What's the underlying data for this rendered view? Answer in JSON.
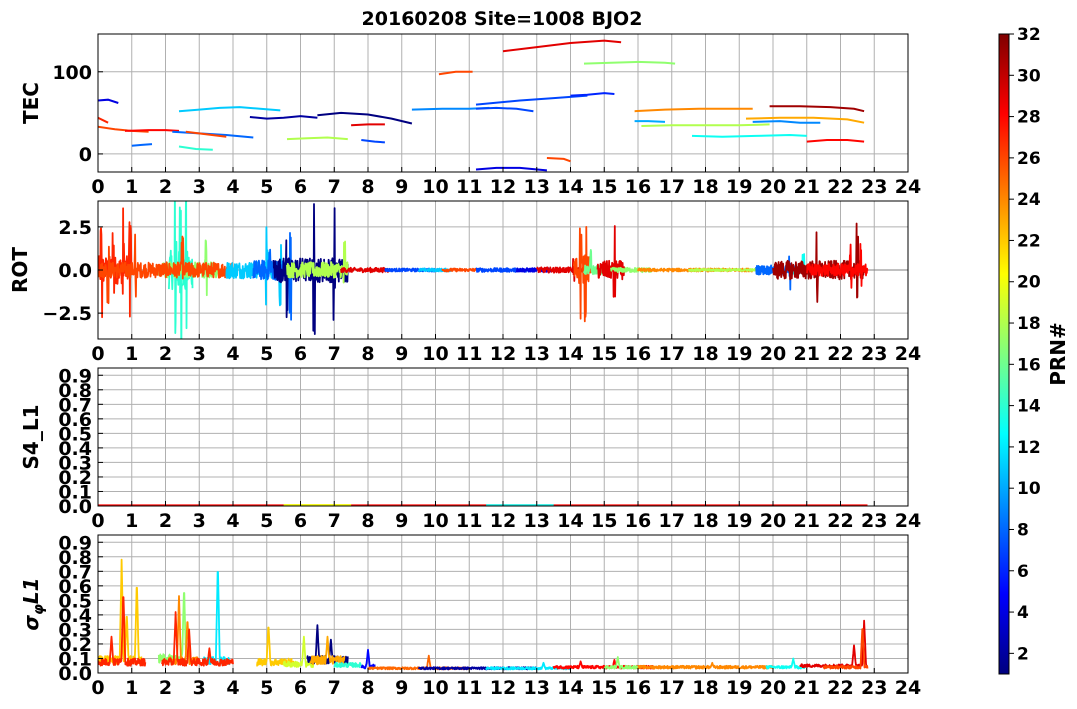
{
  "figure": {
    "title": "20160208 Site=1008 BJO2"
  },
  "chart_data": [
    {
      "type": "line",
      "panel": "tec",
      "ylabel": "TEC",
      "xlim": [
        0,
        24
      ],
      "ylim": [
        -22,
        146
      ],
      "xticks": [
        0,
        1,
        2,
        3,
        4,
        5,
        6,
        7,
        8,
        9,
        10,
        11,
        12,
        13,
        14,
        15,
        16,
        17,
        18,
        19,
        20,
        21,
        22,
        23,
        24
      ],
      "yticks": [
        0,
        100
      ],
      "grid": true,
      "series": [
        {
          "prn": 4,
          "x": [
            0.0,
            0.3,
            0.6
          ],
          "y": [
            65,
            66,
            62
          ]
        },
        {
          "prn": 27,
          "x": [
            0.0,
            0.3
          ],
          "y": [
            44,
            38
          ]
        },
        {
          "prn": 26,
          "x": [
            0.0,
            0.5,
            1.0,
            1.5
          ],
          "y": [
            33,
            30,
            28,
            27
          ]
        },
        {
          "prn": 28,
          "x": [
            0.8,
            1.5,
            2.0,
            2.4
          ],
          "y": [
            28,
            29,
            29,
            28
          ]
        },
        {
          "prn": 8,
          "x": [
            1.0,
            1.3,
            1.6
          ],
          "y": [
            10,
            11,
            12
          ]
        },
        {
          "prn": 11,
          "x": [
            2.4,
            3.0,
            3.6,
            4.2,
            4.8,
            5.4
          ],
          "y": [
            52,
            54,
            56,
            57,
            55,
            53
          ]
        },
        {
          "prn": 14,
          "x": [
            2.4,
            2.9,
            3.4
          ],
          "y": [
            9,
            6,
            5
          ]
        },
        {
          "prn": 8,
          "x": [
            2.2,
            3.0,
            3.8,
            4.6
          ],
          "y": [
            27,
            25,
            23,
            20
          ]
        },
        {
          "prn": 26,
          "x": [
            2.6,
            3.2,
            3.8
          ],
          "y": [
            27,
            24,
            21
          ]
        },
        {
          "prn": 2,
          "x": [
            4.5,
            5.0,
            5.5,
            6.0,
            6.5
          ],
          "y": [
            45,
            43,
            44,
            46,
            44
          ]
        },
        {
          "prn": 18,
          "x": [
            5.6,
            6.2,
            6.8,
            7.4
          ],
          "y": [
            18,
            19,
            20,
            18
          ]
        },
        {
          "prn": 1,
          "x": [
            6.5,
            7.2,
            8.0,
            8.7,
            9.3
          ],
          "y": [
            47,
            50,
            48,
            43,
            37
          ]
        },
        {
          "prn": 29,
          "x": [
            7.5,
            8.0,
            8.5
          ],
          "y": [
            35,
            36,
            36
          ]
        },
        {
          "prn": 7,
          "x": [
            7.8,
            8.2,
            8.5
          ],
          "y": [
            17,
            15,
            14
          ]
        },
        {
          "prn": 9,
          "x": [
            9.3,
            10.2,
            11.0,
            11.6
          ],
          "y": [
            54,
            55,
            55,
            56
          ]
        },
        {
          "prn": 7,
          "x": [
            11.2,
            11.8,
            12.4,
            12.9
          ],
          "y": [
            55,
            56,
            55,
            52
          ]
        },
        {
          "prn": 26,
          "x": [
            10.1,
            10.6,
            11.1
          ],
          "y": [
            97,
            100,
            100
          ]
        },
        {
          "prn": 7,
          "x": [
            11.2,
            12.5,
            13.5,
            14.5
          ],
          "y": [
            60,
            65,
            68,
            71
          ]
        },
        {
          "prn": 6,
          "x": [
            14.0,
            14.5,
            15.0,
            15.3
          ],
          "y": [
            71,
            72,
            74,
            73
          ]
        },
        {
          "prn": 29,
          "x": [
            12.0,
            13.0,
            14.0,
            15.0,
            15.5
          ],
          "y": [
            125,
            130,
            135,
            138,
            136
          ]
        },
        {
          "prn": 17,
          "x": [
            14.4,
            15.2,
            16.0,
            16.8,
            17.1
          ],
          "y": [
            110,
            111,
            112,
            111,
            110
          ]
        },
        {
          "prn": 4,
          "x": [
            11.2,
            11.8,
            12.5,
            13.3
          ],
          "y": [
            -19,
            -17,
            -17,
            -20
          ]
        },
        {
          "prn": 26,
          "x": [
            13.3,
            13.8,
            14.0
          ],
          "y": [
            -5,
            -6,
            -9
          ]
        },
        {
          "prn": 24,
          "x": [
            15.9,
            16.8,
            17.8,
            18.8,
            19.4
          ],
          "y": [
            52,
            54,
            55,
            55,
            55
          ]
        },
        {
          "prn": 18,
          "x": [
            16.1,
            17.0,
            18.0,
            19.0,
            19.9
          ],
          "y": [
            34,
            35,
            35,
            35,
            36
          ]
        },
        {
          "prn": 10,
          "x": [
            15.9,
            16.3,
            16.8
          ],
          "y": [
            40,
            40,
            39
          ]
        },
        {
          "prn": 13,
          "x": [
            17.6,
            18.5,
            19.5,
            20.5,
            21.0
          ],
          "y": [
            22,
            21,
            22,
            23,
            22
          ]
        },
        {
          "prn": 9,
          "x": [
            19.4,
            20.2,
            20.8,
            21.4
          ],
          "y": [
            39,
            40,
            38,
            38
          ]
        },
        {
          "prn": 23,
          "x": [
            19.2,
            20.2,
            21.2,
            22.2,
            22.7
          ],
          "y": [
            43,
            44,
            44,
            42,
            38
          ]
        },
        {
          "prn": 31,
          "x": [
            19.9,
            20.8,
            21.7,
            22.4,
            22.7
          ],
          "y": [
            58,
            58,
            57,
            55,
            52
          ]
        },
        {
          "prn": 28,
          "x": [
            21.0,
            21.6,
            22.2,
            22.7
          ],
          "y": [
            15,
            17,
            17,
            15
          ]
        }
      ]
    },
    {
      "type": "line",
      "panel": "rot",
      "ylabel": "ROT",
      "xlim": [
        0,
        24
      ],
      "ylim": [
        -4,
        4
      ],
      "xticks": [
        0,
        1,
        2,
        3,
        4,
        5,
        6,
        7,
        8,
        9,
        10,
        11,
        12,
        13,
        14,
        15,
        16,
        17,
        18,
        19,
        20,
        21,
        22,
        23,
        24
      ],
      "yticks": [
        -2.5,
        0.0,
        2.5
      ],
      "grid": true,
      "noisy_series": [
        {
          "prn": 27,
          "x0": 0.0,
          "x1": 1.0,
          "amp": 1.8,
          "spikes": [
            0.1,
            0.45,
            0.75,
            0.95
          ]
        },
        {
          "prn": 14,
          "x0": 2.1,
          "x1": 2.8,
          "amp": 2.5,
          "spikes": [
            2.3,
            2.45,
            2.6
          ]
        },
        {
          "prn": 17,
          "x0": 1.8,
          "x1": 3.6,
          "amp": 1.0,
          "spikes": [
            3.2
          ]
        },
        {
          "prn": 26,
          "x0": 0.0,
          "x1": 4.0,
          "amp": 1.0,
          "spikes": [
            0.3,
            1.1,
            2.5
          ]
        },
        {
          "prn": 11,
          "x0": 3.8,
          "x1": 5.6,
          "amp": 1.1,
          "spikes": [
            5.0,
            5.4
          ]
        },
        {
          "prn": 8,
          "x0": 4.6,
          "x1": 5.8,
          "amp": 1.3,
          "spikes": [
            5.1,
            5.7
          ]
        },
        {
          "prn": 1,
          "x0": 5.2,
          "x1": 7.4,
          "amp": 1.6,
          "spikes": [
            5.6,
            6.4,
            7.0
          ]
        },
        {
          "prn": 18,
          "x0": 5.6,
          "x1": 7.4,
          "amp": 1.0,
          "spikes": [
            7.3
          ]
        },
        {
          "prn": 29,
          "x0": 7.2,
          "x1": 8.6,
          "amp": 0.3,
          "spikes": []
        },
        {
          "prn": 7,
          "x0": 8.5,
          "x1": 10.0,
          "amp": 0.2,
          "spikes": []
        },
        {
          "prn": 11,
          "x0": 9.5,
          "x1": 10.5,
          "amp": 0.2,
          "spikes": []
        },
        {
          "prn": 26,
          "x0": 10.2,
          "x1": 11.2,
          "amp": 0.2,
          "spikes": []
        },
        {
          "prn": 7,
          "x0": 11.2,
          "x1": 12.8,
          "amp": 0.25,
          "spikes": []
        },
        {
          "prn": 4,
          "x0": 12.4,
          "x1": 13.4,
          "amp": 0.25,
          "spikes": []
        },
        {
          "prn": 29,
          "x0": 13.0,
          "x1": 14.4,
          "amp": 0.35,
          "spikes": [
            14.1
          ]
        },
        {
          "prn": 26,
          "x0": 14.1,
          "x1": 14.6,
          "amp": 1.8,
          "spikes": [
            14.3,
            14.45
          ]
        },
        {
          "prn": 16,
          "x0": 14.4,
          "x1": 15.2,
          "amp": 0.6,
          "spikes": [
            14.6
          ]
        },
        {
          "prn": 29,
          "x0": 14.8,
          "x1": 15.6,
          "amp": 1.2,
          "spikes": [
            15.3
          ]
        },
        {
          "prn": 17,
          "x0": 15.2,
          "x1": 16.4,
          "amp": 0.3,
          "spikes": []
        },
        {
          "prn": 24,
          "x0": 16.0,
          "x1": 19.4,
          "amp": 0.2,
          "spikes": []
        },
        {
          "prn": 18,
          "x0": 17.5,
          "x1": 19.5,
          "amp": 0.15,
          "spikes": []
        },
        {
          "prn": 8,
          "x0": 19.5,
          "x1": 21.0,
          "amp": 0.6,
          "spikes": [
            20.5
          ]
        },
        {
          "prn": 13,
          "x0": 20.5,
          "x1": 21.3,
          "amp": 0.5,
          "spikes": [
            20.9
          ]
        },
        {
          "prn": 31,
          "x0": 20.0,
          "x1": 22.7,
          "amp": 1.2,
          "spikes": [
            21.3,
            22.5
          ]
        },
        {
          "prn": 28,
          "x0": 21.0,
          "x1": 22.8,
          "amp": 0.8,
          "spikes": [
            22.3,
            22.6
          ]
        }
      ]
    },
    {
      "type": "line",
      "panel": "s4",
      "ylabel": "S4_L1",
      "xlim": [
        0,
        24
      ],
      "ylim": [
        0,
        0.95
      ],
      "xticks": [
        0,
        1,
        2,
        3,
        4,
        5,
        6,
        7,
        8,
        9,
        10,
        11,
        12,
        13,
        14,
        15,
        16,
        17,
        18,
        19,
        20,
        21,
        22,
        23,
        24
      ],
      "yticks": [
        0.0,
        0.1,
        0.2,
        0.3,
        0.4,
        0.5,
        0.6,
        0.7,
        0.8,
        0.9
      ],
      "grid": true,
      "flat_series": [
        {
          "prn": 28,
          "x0": 0.0,
          "x1": 22.8,
          "y": 0.004
        },
        {
          "prn": 20,
          "x0": 5.5,
          "x1": 7.5,
          "y": 0.006
        },
        {
          "prn": 13,
          "x0": 11.5,
          "x1": 13.5,
          "y": 0.005
        }
      ]
    },
    {
      "type": "line",
      "panel": "sigma",
      "ylabel": "σφL1",
      "xlim": [
        0,
        24
      ],
      "ylim": [
        0,
        0.95
      ],
      "xticks": [
        0,
        1,
        2,
        3,
        4,
        5,
        6,
        7,
        8,
        9,
        10,
        11,
        12,
        13,
        14,
        15,
        16,
        17,
        18,
        19,
        20,
        21,
        22,
        23,
        24
      ],
      "yticks": [
        0.0,
        0.1,
        0.2,
        0.3,
        0.4,
        0.5,
        0.6,
        0.7,
        0.8,
        0.9
      ],
      "grid": true,
      "noisy_series": [
        {
          "prn": 22,
          "x0": 0.0,
          "x1": 1.3,
          "base": 0.06,
          "amp": 0.06,
          "spikes": [
            [
              0.7,
              0.78
            ],
            [
              0.85,
              0.42
            ],
            [
              1.15,
              0.64
            ]
          ]
        },
        {
          "prn": 27,
          "x0": 0.0,
          "x1": 1.4,
          "base": 0.05,
          "amp": 0.05,
          "spikes": [
            [
              0.75,
              0.57
            ],
            [
              0.4,
              0.25
            ]
          ]
        },
        {
          "prn": 17,
          "x0": 1.8,
          "x1": 2.6,
          "base": 0.07,
          "amp": 0.06,
          "spikes": [
            [
              2.55,
              0.6
            ],
            [
              1.5,
              0.35
            ]
          ]
        },
        {
          "prn": 24,
          "x0": 2.1,
          "x1": 3.0,
          "base": 0.06,
          "amp": 0.05,
          "spikes": [
            [
              2.4,
              0.53
            ],
            [
              2.65,
              0.38
            ]
          ]
        },
        {
          "prn": 12,
          "x0": 3.1,
          "x1": 3.9,
          "base": 0.06,
          "amp": 0.05,
          "spikes": [
            [
              3.55,
              0.76
            ]
          ]
        },
        {
          "prn": 27,
          "x0": 1.9,
          "x1": 4.0,
          "base": 0.05,
          "amp": 0.05,
          "spikes": [
            [
              2.3,
              0.42
            ],
            [
              3.3,
              0.17
            ],
            [
              2.7,
              0.3
            ]
          ]
        },
        {
          "prn": 22,
          "x0": 4.7,
          "x1": 5.8,
          "base": 0.05,
          "amp": 0.05,
          "spikes": [
            [
              5.05,
              0.34
            ]
          ]
        },
        {
          "prn": 19,
          "x0": 5.5,
          "x1": 6.4,
          "base": 0.04,
          "amp": 0.04,
          "spikes": [
            [
              6.1,
              0.25
            ]
          ]
        },
        {
          "prn": 1,
          "x0": 6.2,
          "x1": 7.4,
          "base": 0.06,
          "amp": 0.06,
          "spikes": [
            [
              6.5,
              0.33
            ],
            [
              6.9,
              0.23
            ]
          ]
        },
        {
          "prn": 23,
          "x0": 6.3,
          "x1": 7.3,
          "base": 0.06,
          "amp": 0.06,
          "spikes": [
            [
              6.8,
              0.25
            ]
          ]
        },
        {
          "prn": 14,
          "x0": 7.0,
          "x1": 7.8,
          "base": 0.04,
          "amp": 0.03,
          "spikes": []
        },
        {
          "prn": 5,
          "x0": 7.8,
          "x1": 8.2,
          "base": 0.03,
          "amp": 0.03,
          "spikes": [
            [
              8.0,
              0.16
            ]
          ]
        },
        {
          "prn": 25,
          "x0": 8.0,
          "x1": 11.0,
          "base": 0.025,
          "amp": 0.015,
          "spikes": [
            [
              9.8,
              0.12
            ]
          ]
        },
        {
          "prn": 2,
          "x0": 9.5,
          "x1": 13.0,
          "base": 0.025,
          "amp": 0.015,
          "spikes": []
        },
        {
          "prn": 12,
          "x0": 11.5,
          "x1": 14.0,
          "base": 0.025,
          "amp": 0.015,
          "spikes": [
            [
              13.2,
              0.07
            ]
          ]
        },
        {
          "prn": 28,
          "x0": 13.5,
          "x1": 16.5,
          "base": 0.03,
          "amp": 0.02,
          "spikes": [
            [
              14.3,
              0.08
            ],
            [
              15.3,
              0.09
            ]
          ]
        },
        {
          "prn": 17,
          "x0": 15.0,
          "x1": 16.0,
          "base": 0.03,
          "amp": 0.02,
          "spikes": [
            [
              15.4,
              0.11
            ]
          ]
        },
        {
          "prn": 24,
          "x0": 16.0,
          "x1": 20.0,
          "base": 0.03,
          "amp": 0.02,
          "spikes": [
            [
              18.2,
              0.07
            ]
          ]
        },
        {
          "prn": 13,
          "x0": 19.8,
          "x1": 21.0,
          "base": 0.03,
          "amp": 0.02,
          "spikes": [
            [
              20.6,
              0.1
            ]
          ]
        },
        {
          "prn": 29,
          "x0": 20.8,
          "x1": 22.8,
          "base": 0.04,
          "amp": 0.02,
          "spikes": [
            [
              22.4,
              0.19
            ],
            [
              22.7,
              0.36
            ]
          ]
        },
        {
          "prn": 26,
          "x0": 21.5,
          "x1": 22.8,
          "base": 0.03,
          "amp": 0.02,
          "spikes": [
            [
              22.65,
              0.33
            ]
          ]
        }
      ]
    }
  ],
  "colorbar": {
    "label": "PRN#",
    "min": 1,
    "max": 32,
    "ticks": [
      2,
      4,
      6,
      8,
      10,
      12,
      14,
      16,
      18,
      20,
      22,
      24,
      26,
      28,
      30,
      32
    ],
    "colormap": "jet"
  },
  "style": {
    "grid_color": "#b0b0b0",
    "zero_line_color": "#808080"
  }
}
